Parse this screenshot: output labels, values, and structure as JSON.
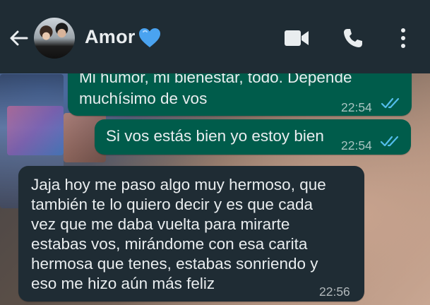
{
  "header": {
    "contact_name": "Amor",
    "heart_emoji": "💙",
    "icons": [
      "back-arrow-icon",
      "video-call-icon",
      "voice-call-icon",
      "more-options-icon"
    ]
  },
  "messages": [
    {
      "direction": "outgoing",
      "lines": [
        "Mi humor, mi bienestar, todo. Depende",
        "muchísimo de vos"
      ],
      "time": "22:54",
      "status": "read"
    },
    {
      "direction": "outgoing",
      "lines": [
        "Si vos estás bien yo estoy bien"
      ],
      "time": "22:54",
      "status": "read"
    },
    {
      "direction": "incoming",
      "lines": [
        "Jaja hoy me paso algo muy hermoso, que",
        "también te lo quiero decir y es que cada",
        "vez que me daba vuelta para mirarte",
        "estabas vos, mirándome con esa carita",
        "hermosa que tenes, estabas sonriendo y",
        "eso me hizo aún más feliz"
      ],
      "time": "22:56"
    }
  ],
  "colors": {
    "header_bg": "#1f2c34",
    "outgoing_bubble": "#005c4b",
    "incoming_bubble": "#1f2c34",
    "read_ticks": "#53bdeb",
    "heart": "#4aa3f0"
  }
}
